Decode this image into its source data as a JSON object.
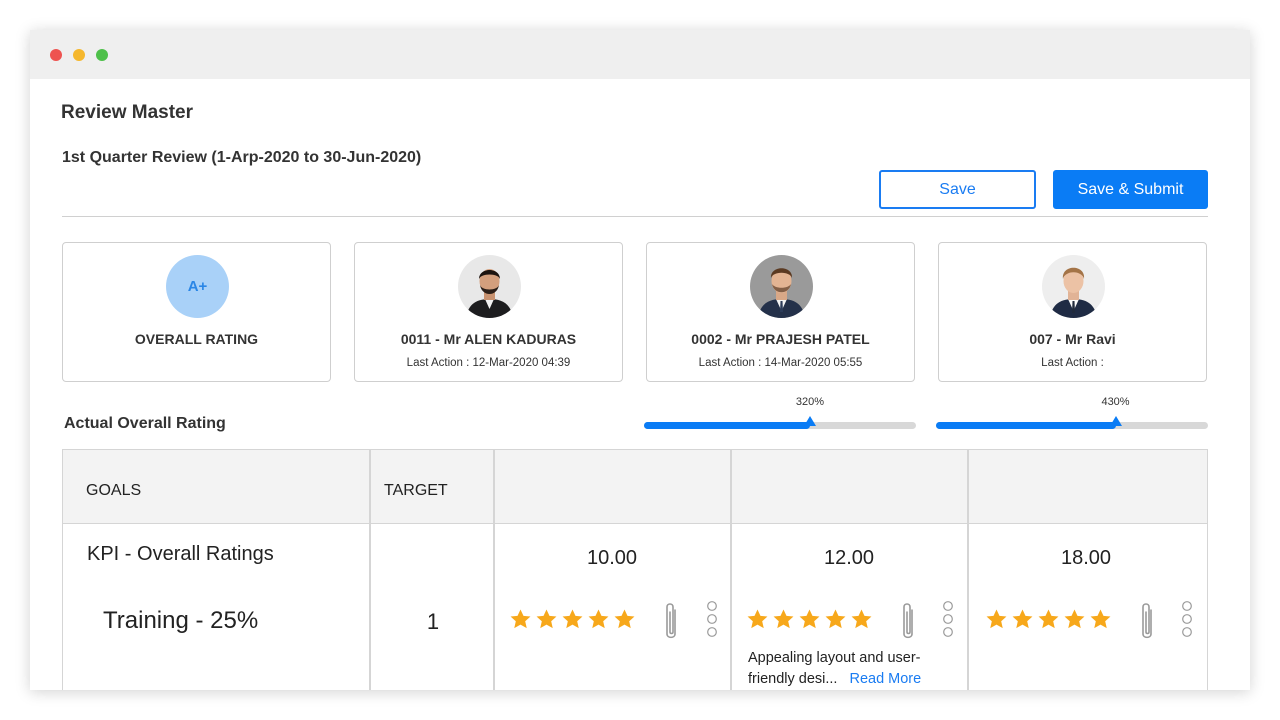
{
  "page": {
    "title": "Review Master",
    "subtitle": "1st Quarter Review (1-Arp-2020 to 30-Jun-2020)"
  },
  "buttons": {
    "save": "Save",
    "save_submit": "Save & Submit"
  },
  "cards": {
    "overall": {
      "grade": "A+",
      "label": "OVERALL RATING"
    },
    "reviewer1": {
      "name": "0011 - Mr ALEN KADURAS",
      "last_action": "Last Action : 12-Mar-2020 04:39"
    },
    "reviewer2": {
      "name": "0002 - Mr PRAJESH PATEL",
      "last_action": "Last Action : 14-Mar-2020 05:55"
    },
    "reviewer3": {
      "name": "007 - Mr Ravi",
      "last_action": "Last Action :"
    }
  },
  "actual_overall_rating": {
    "label": "Actual Overall Rating",
    "slider1": {
      "label": "320%",
      "fraction": 0.61
    },
    "slider2": {
      "label": "430%",
      "fraction": 0.66
    }
  },
  "table": {
    "headers": {
      "goals": "GOALS",
      "target": "TARGET"
    },
    "kpi_title": "KPI - Overall Ratings",
    "row_label": "Training - 25%",
    "target_value": "1",
    "scores": [
      "10.00",
      "12.00",
      "18.00"
    ],
    "stars": [
      5,
      5,
      5
    ],
    "comment": {
      "text": "Appealing layout and user-friendly desi...",
      "link": "Read More"
    }
  },
  "colors": {
    "accent": "#0a7cf5",
    "star": "#f7a81b",
    "grade_bg": "#a9d1f8"
  }
}
